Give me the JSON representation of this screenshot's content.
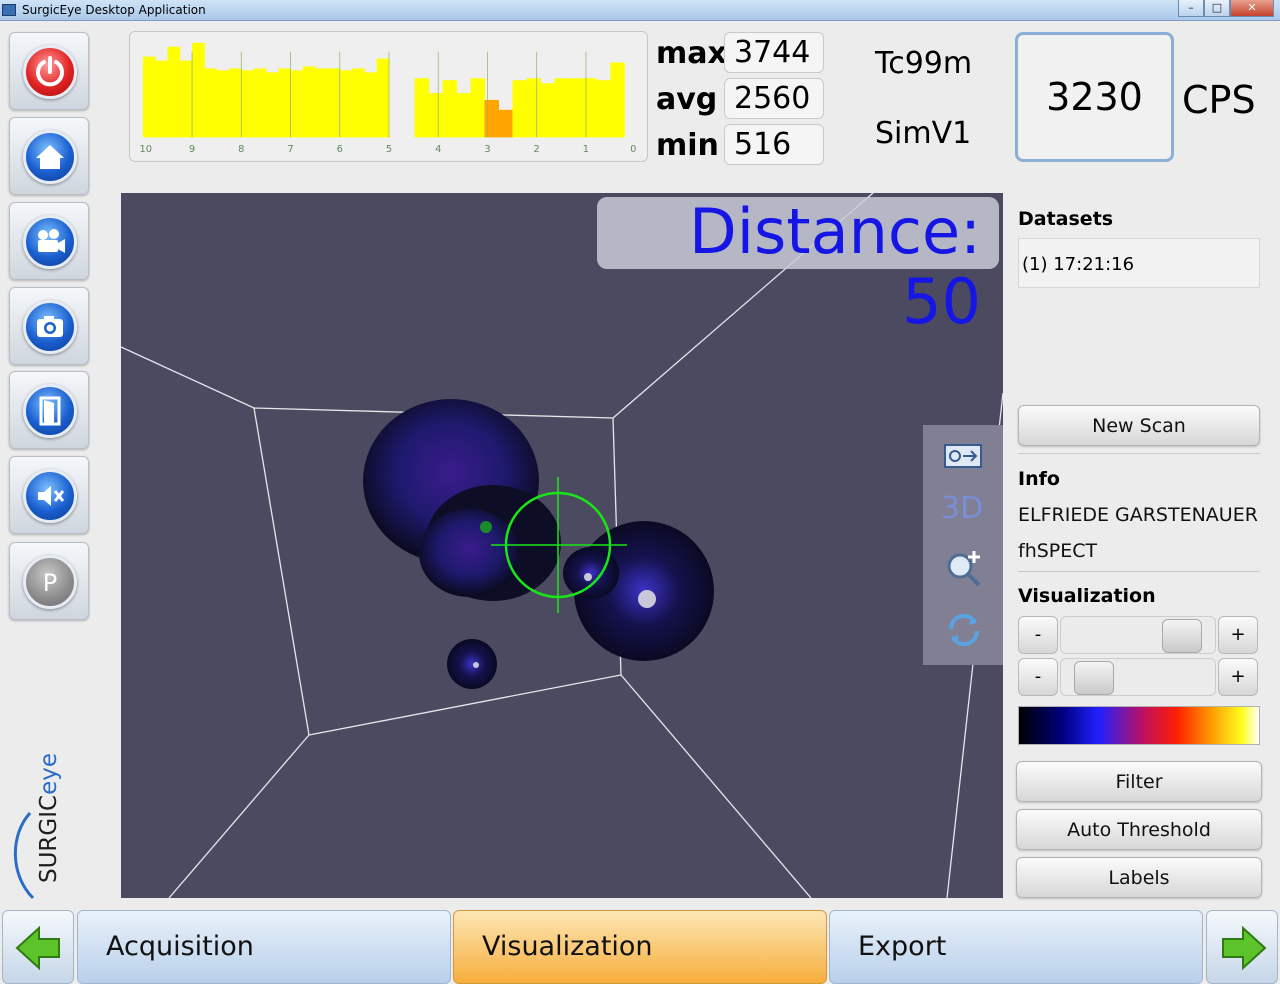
{
  "window": {
    "title": "SurgicEye Desktop Application"
  },
  "histogram": {
    "tick_labels": [
      "10",
      "9",
      "8",
      "7",
      "6",
      "5",
      "4",
      "3",
      "2",
      "1",
      "0"
    ],
    "bar_color": "#ffff00",
    "highlight_color": "#ffa500"
  },
  "stats": {
    "max_label": "max",
    "max_value": "3744",
    "avg_label": "avg",
    "avg_value": "2560",
    "min_label": "min",
    "min_value": "516"
  },
  "source": {
    "isotope": "Tc99m",
    "simulator": "SimV1"
  },
  "counter": {
    "value": "3230",
    "unit": "CPS"
  },
  "view": {
    "distance_text": "Distance: 50",
    "mode_3d_label": "3D"
  },
  "datasets": {
    "title": "Datasets",
    "items": [
      "(1) 17:21:16"
    ]
  },
  "new_scan_label": "New Scan",
  "info": {
    "title": "Info",
    "patient": "ELFRIEDE GARSTENAUER",
    "modality": "fhSPECT"
  },
  "visualization": {
    "title": "Visualization",
    "minus_label": "-",
    "plus_label": "+",
    "slider1_level": 0.9,
    "slider2_level": 0.1
  },
  "buttons": {
    "filter": "Filter",
    "auto_threshold": "Auto Threshold",
    "labels": "Labels"
  },
  "nav": {
    "tabs": [
      "Acquisition",
      "Visualization",
      "Export"
    ],
    "active_tab": "Visualization"
  },
  "logo_text": "SURGICeye",
  "accent_color": "#1515e6",
  "icons": [
    "power-icon",
    "home-icon",
    "video-camera-icon",
    "camera-icon",
    "door-exit-icon",
    "mute-icon",
    "parking-icon"
  ]
}
